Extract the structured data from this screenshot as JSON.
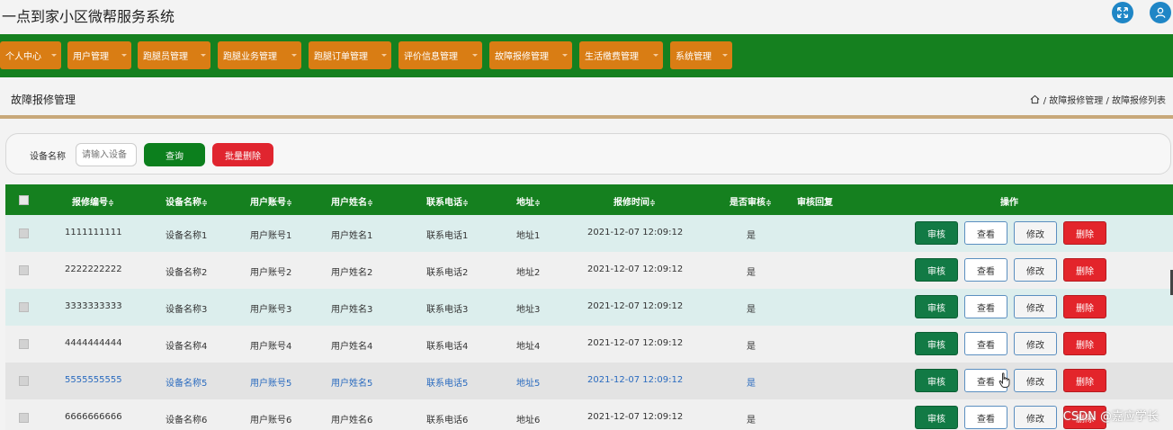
{
  "app": {
    "title": "一点到家小区微帮服务系统"
  },
  "nav": {
    "items": [
      {
        "label": "个人中心"
      },
      {
        "label": "用户管理"
      },
      {
        "label": "跑腿员管理"
      },
      {
        "label": "跑腿业务管理"
      },
      {
        "label": "跑腿订单管理"
      },
      {
        "label": "评价信息管理"
      },
      {
        "label": "故障报修管理"
      },
      {
        "label": "生活缴费管理"
      },
      {
        "label": "系统管理"
      }
    ]
  },
  "section": {
    "title": "故障报修管理",
    "breadcrumb": "/ 故障报修管理 / 故障报修列表"
  },
  "search": {
    "label": "设备名称",
    "placeholder": "请输入设备",
    "query_label": "查询",
    "batch_delete_label": "批量删除"
  },
  "table": {
    "columns": [
      "报修编号",
      "设备名称",
      "用户账号",
      "用户姓名",
      "联系电话",
      "地址",
      "报修时间",
      "是否审核",
      "审核回复",
      "操作"
    ],
    "sort_icon": "≑",
    "actions": {
      "audit": "审核",
      "view": "查看",
      "edit": "修改",
      "delete": "删除"
    },
    "rows": [
      {
        "id": "1111111111",
        "device": "设备名称1",
        "account": "用户账号1",
        "name": "用户姓名1",
        "phone": "联系电话1",
        "address": "地址1",
        "time": "2021-12-07 12:09:12",
        "audited": "是",
        "reply": ""
      },
      {
        "id": "2222222222",
        "device": "设备名称2",
        "account": "用户账号2",
        "name": "用户姓名2",
        "phone": "联系电话2",
        "address": "地址2",
        "time": "2021-12-07 12:09:12",
        "audited": "是",
        "reply": ""
      },
      {
        "id": "3333333333",
        "device": "设备名称3",
        "account": "用户账号3",
        "name": "用户姓名3",
        "phone": "联系电话3",
        "address": "地址3",
        "time": "2021-12-07 12:09:12",
        "audited": "是",
        "reply": ""
      },
      {
        "id": "4444444444",
        "device": "设备名称4",
        "account": "用户账号4",
        "name": "用户姓名4",
        "phone": "联系电话4",
        "address": "地址4",
        "time": "2021-12-07 12:09:12",
        "audited": "是",
        "reply": ""
      },
      {
        "id": "5555555555",
        "device": "设备名称5",
        "account": "用户账号5",
        "name": "用户姓名5",
        "phone": "联系电话5",
        "address": "地址5",
        "time": "2021-12-07 12:09:12",
        "audited": "是",
        "reply": ""
      },
      {
        "id": "6666666666",
        "device": "设备名称6",
        "account": "用户账号6",
        "name": "用户姓名6",
        "phone": "联系电话6",
        "address": "地址6",
        "time": "2021-12-07 12:09:12",
        "audited": "是",
        "reply": ""
      }
    ]
  },
  "watermark": "CSDN @嘉应学长",
  "icons": {
    "fullscreen": "expand-icon",
    "user": "user-avatar-icon",
    "home": "home-icon",
    "cursor": "hand-pointer-icon"
  },
  "colors": {
    "nav_bg": "#15801f",
    "nav_item": "#d97d14",
    "query": "#0c7f1d",
    "delete": "#e0252f",
    "audit": "#127a45",
    "row_alt": "#dceeed"
  }
}
